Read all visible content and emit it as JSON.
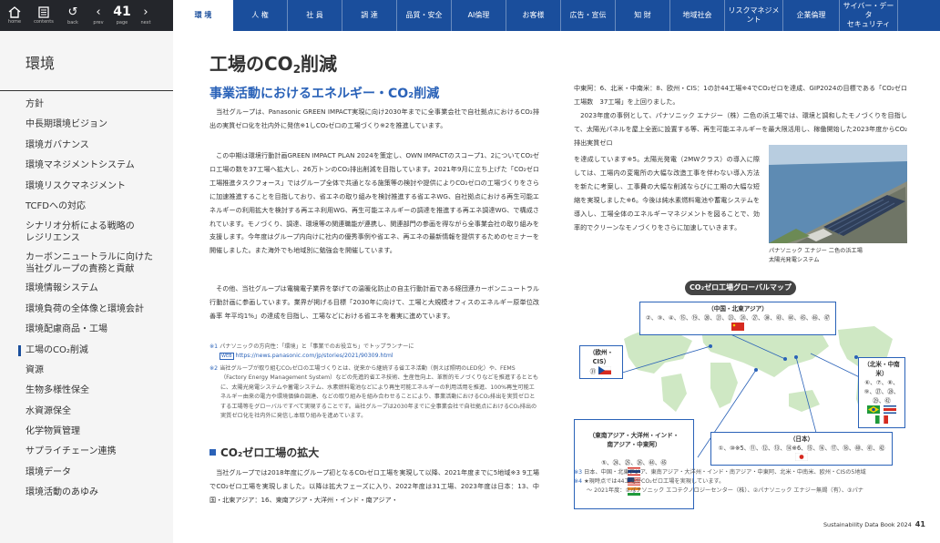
{
  "toolbar": {
    "home_label": "home",
    "contents_label": "contents",
    "back_label": "back",
    "prev_label": "prev",
    "page_label": "page",
    "page_number": "41",
    "next_label": "next"
  },
  "tabs": [
    "環 境",
    "人 権",
    "社 員",
    "調 達",
    "品質・安全",
    "AI倫理",
    "お客様",
    "広告・宣伝",
    "知 財",
    "地域社会",
    "リスクマネジメント",
    "企業倫理",
    "サイバー・データ\nセキュリティ"
  ],
  "sidebar": {
    "title": "環境",
    "items": [
      "方針",
      "中長期環境ビジョン",
      "環境ガバナンス",
      "環境マネジメントシステム",
      "環境リスクマネジメント",
      "TCFDへの対応",
      "シナリオ分析による戦略の\nレジリエンス",
      "カーボンニュートラルに向けた\n当社グループの責務と貢献",
      "環境情報システム",
      "環境負荷の全体像と環境会計",
      "環境配慮商品・工場",
      "工場のCO₂削減",
      "資源",
      "生物多様性保全",
      "水資源保全",
      "化学物質管理",
      "サプライチェーン連携",
      "環境データ",
      "環境活動のあゆみ"
    ]
  },
  "page": {
    "title_pre": "工場のCO",
    "title_sub": "2",
    "title_post": "削減",
    "section_title": "事業活動におけるエネルギー・CO₂削減",
    "para1": "当社グループは、Panasonic GREEN IMPACT実現に向け2030年までに全事業会社で自社拠点におけるCO₂排出の実質ゼロ化を社内外に発信※1しCO₂ゼロの工場づくり※2を推進しています。",
    "para2": "この中期は環境行動計画GREEN IMPACT PLAN 2024を策定し、OWN IMPACTのスコープ1、2についてCO₂ゼロ工場の数を37工場へ拡大し、26万トンのCO₂排出削減を目指しています。2021年9月に立ち上げた「CO₂ゼロ工場推進タスクフォース」ではグループ全体で共通となる施策等の検討や提供によりCO₂ゼロの工場づくりをさらに加速推進することを目指しており、省エネの取り組みを検討推進する省エネWG、自社拠点における再生可能エネルギーの利用拡大を検討する再エネ利用WG、再生可能エネルギーの調達を推進する再エネ調達WG、で構成されています。モノづくり、調達、環境等の関連職能が連携し、関連部門の参画を得ながら全事業会社の取り組みを支援します。今年度はグループ内向けに社内の優秀事例や省エネ、再エネの最新情報を提供するためのセミナーを開催しました。また海外でも地域別に勉強会を開催しています。",
    "para3": "その他、当社グループは電機電子業界を挙げての温暖化防止の自主行動計画である経団連カーボンニュートラル行動計画に参画しています。業界が掲げる目標「2030年に向けて、工場と大規模オフィスのエネルギー原単位改善率 年平均1%」の達成を目指し、工場などにおける省エネを着実に進めています。",
    "fn1_mark": "※1",
    "fn1_text": "パナソニックの方向性：「環境」と「事業でのお役立ち」でトップランナーに",
    "fn1_url_icon": "WEB",
    "fn1_url": "https://news.panasonic.com/jp/stories/2021/90309.html",
    "fn2_mark": "※2",
    "fn2_text": "当社グループが取り組むCO₂ゼロの工場づくりとは、従来から継続する省エネ活動（例えば照明のLED化）や、FEMS（Factory Energy Management System）などの先進的省エネ技術、生産性向上、革新的モノづくりなどを推進するとともに、太陽光発電システムや蓄電システム、水素燃料電池などにより再生可能エネルギーの利用活用を推進、100%再生可能エネルギー由来の電力や環境価値の調達、などの取り組みを組み合わせることにより、事業活動におけるCO₂排出を実質ゼロとする工場等をグローバルですべて実現することです。当社グループは2030年までに全事業会社で自社拠点におけるCO₂排出の実質ゼロ化を社内外に発信し本取り組みを進めています。",
    "sub_title": "CO₂ゼロ工場の拡大",
    "para4": "当社グループでは2018年度にグループ初となるCO₂ゼロ工場を実現して以降、2021年度までに5地域※3 9工場でCO₂ゼロ工場を実現しました。以降は拡大フェーズに入り、2022年度は31工場、2023年度は日本：13、中国・北東アジア：16、東南アジア・大洋州・インド・南アジア・",
    "rpara1": "中東阿：6、北米・中南米：8、欧州・CIS：1の計44工場※4でCO₂ゼロを達成、GIP2024の目標である「CO₂ゼロ工場数　37工場」を上回りました。",
    "rpara2_lead": "2023年度の事例として、パナソニック エナジー（株）二色の浜工場では、環境と調和したモノづくりを目指して、太陽光パネルを屋上全面に設置する等、再生可能エネルギーを最大限活用し、稼働開始した2023年度からCO₂排出実質ゼロ",
    "rpara2_rest": "を達成しています※5。太陽光発電（2MWクラス）の導入に際しては、工場内の変電所の大幅な改造工事を伴わない導入方法を新たに考案し、工事費の大幅な削減ならびに工期の大幅な短縮を実現しました※6。今後は純水素燃料電池や蓄電システムを導入し、工場全体のエネルギーマネジメントを図ることで、効率的でクリーンなモノづくりをさらに加速していきます。",
    "photo_caption": "パナソニック エナジー 二色の浜工場\n太陽光発電システム"
  },
  "map": {
    "title": "CO₂ゼロ工場グローバルマップ",
    "china": {
      "name": "（中国・北東アジア）",
      "ids": "②、③、④、⑮、⑲、⑳、㉑、㉓、㉔、㉗、㊳、㊸、㊹、㊺、㊻、㊼"
    },
    "europe": {
      "name": "（欧州・CIS）",
      "ids": "㉛"
    },
    "americas": {
      "name": "（北米・中南米）",
      "ids": "⑥、⑦、⑧、⑨、㉗、㉘、㉙、㊷"
    },
    "asia": {
      "name": "（東南アジア・大洋州・インド・\n南アジア・中東阿）",
      "ids": "⑤、㉔、㉕、㉖、㊹、㊺"
    },
    "japan": {
      "name": "（日本）",
      "ids": "①、⑩※5、⑪、⑫、⑬、⑭※6、⑮、⑯、⑰、⑱、㊵、㊶、㊷"
    },
    "colors": {
      "land": "#cfe8c4",
      "ocean": "#ffffff",
      "border": "#2a62b8"
    }
  },
  "notes": {
    "n3_mark": "※3",
    "n3": "日本、中国・北東アジア、東南アジア・大洋州・インド・南アジア・中東阿、北米・中南米、欧州・CISの5地域",
    "n4_mark": "※4",
    "n4": "★現時点では44工場がCO₂ゼロ工場を実現しています。",
    "n4b": "～ 2021年度：①パナソニック エコテクノロジーセンター（株）、②パナソニック エナジー無錫（有）、③パナ"
  },
  "footer": {
    "book": "Sustainability Data Book 2024",
    "page": "41"
  }
}
